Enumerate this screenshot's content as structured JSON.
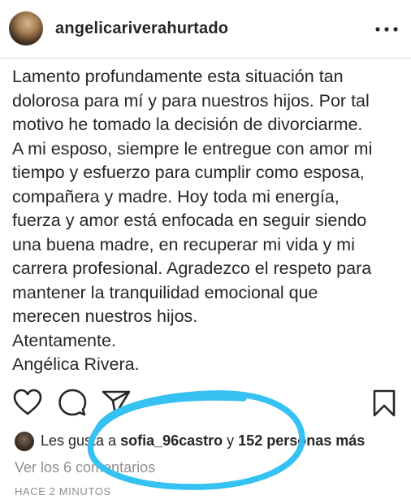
{
  "header": {
    "username": "angelicariverahurtado",
    "avatar_icon": "profile-photo",
    "more_icon": "more-horizontal-icon"
  },
  "post": {
    "caption": "Lamento profundamente esta situación tan\ndolorosa para mí y para nuestros hijos. Por tal\nmotivo he tomado la decisión de divorciarme.\nA mi esposo, siempre le entregue con amor mi\ntiempo y esfuerzo para cumplir como esposa,\ncompañera y madre. Hoy toda mi energía,\nfuerza y amor está enfocada en seguir siendo\nuna buena madre, en recuperar mi vida y mi\ncarrera profesional. Agradezco el respeto para\nmantener la tranquilidad emocional que\nmerecen nuestros hijos.\nAtentamente.\nAngélica Rivera."
  },
  "actions": {
    "like_icon": "heart-icon",
    "comment_icon": "comment-icon",
    "share_icon": "send-icon",
    "save_icon": "bookmark-icon"
  },
  "likes": {
    "prefix": "Les gusta a ",
    "user": "sofia_96castro",
    "connector": " y ",
    "others": "152 personas más"
  },
  "comments": {
    "label": "Ver los 6 comentarios"
  },
  "timestamp": "HACE 2 MINUTOS",
  "colors": {
    "text": "#262626",
    "muted": "#8e8e8e",
    "highlight": "#35c1f1"
  }
}
